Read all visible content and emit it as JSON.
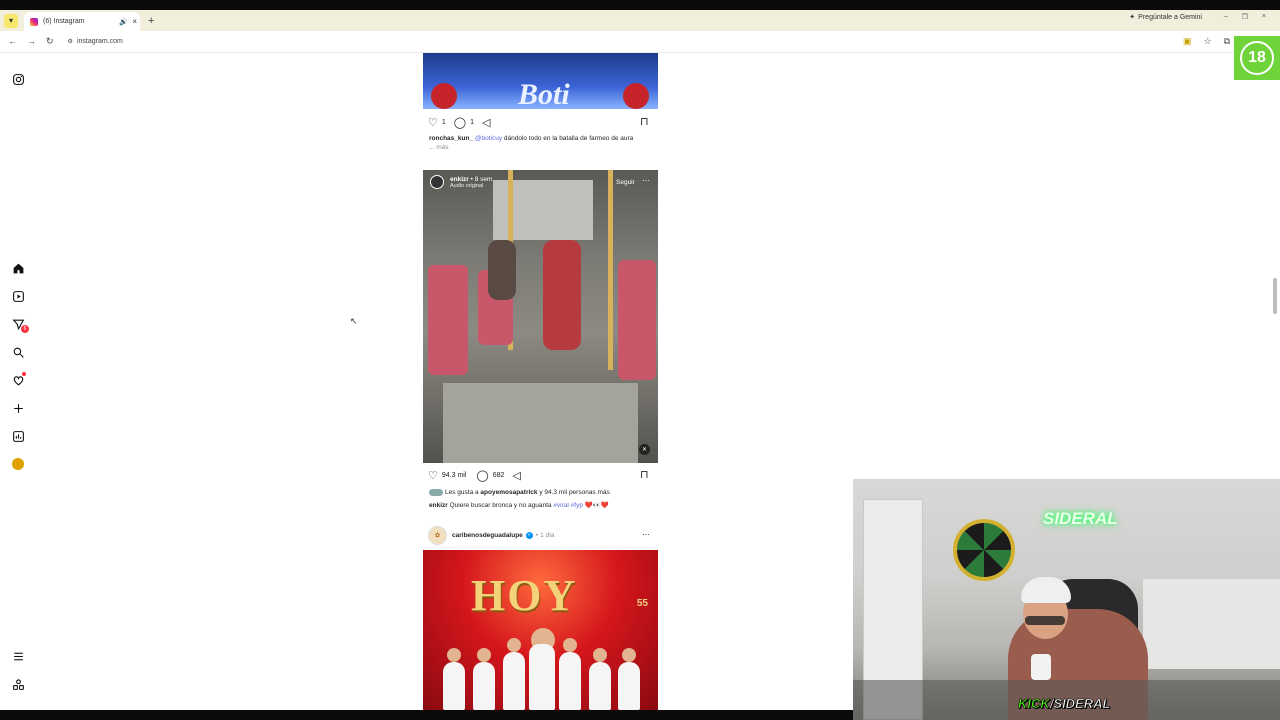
{
  "browser": {
    "tab_title": "(6) Instagram",
    "url": "instagram.com",
    "gemini_label": "Pregúntale a Gemini",
    "new_tab_label": "+",
    "tab_close": "×",
    "win_min": "–",
    "win_max": "❐",
    "win_close": "×"
  },
  "sidebar": {
    "notifications_badge": "6"
  },
  "post1": {
    "likes": "1",
    "comments": "1",
    "caption_user": "ronchas_kun_",
    "caption_tag": "@boticuy",
    "caption_text": " dándolo todo en la batalla de farmeo de aura",
    "more": "... más",
    "image_text": "Boti"
  },
  "post2": {
    "user": "enkizr",
    "time": "8 sem",
    "audio": "Audio original",
    "follow": "Seguir",
    "likes": "94.3 mil",
    "comments": "682",
    "liked_by_prefix": "Les gusta a ",
    "liked_by_user": "apoyemosapatrick",
    "liked_by_suffix": " y 94.3 mil personas más",
    "caption_user": "enkizr",
    "caption_text": " Quiere buscar bronca y no aguanta ",
    "caption_tags": "#viral #fyp",
    "caption_emoji": "❤️👀❤️"
  },
  "post3": {
    "user": "caribenosdeguadalupe",
    "time": "1 día",
    "poster_title": "HOY",
    "poster_badge": "55"
  },
  "overlays": {
    "age_badge": "18",
    "webcam_brand_k": "KICK",
    "webcam_brand_rest": "/SIDERAL",
    "neon_sign": "SIDERAL"
  },
  "colors": {
    "accent_link": "#5b6be0",
    "badge_red": "#ff3040",
    "kick_green": "#53fc18"
  }
}
